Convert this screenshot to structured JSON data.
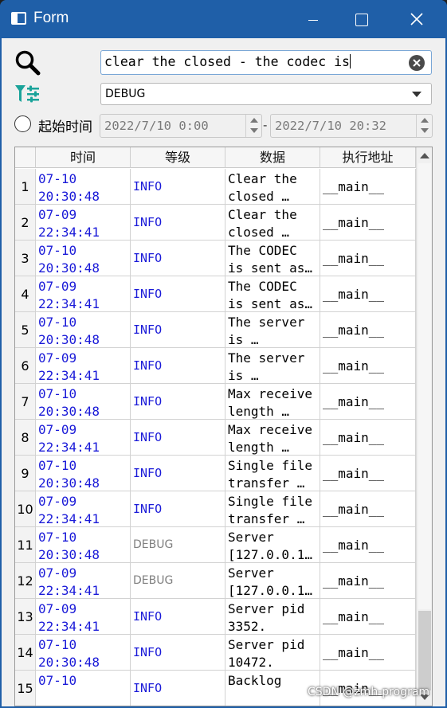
{
  "window": {
    "title": "Form"
  },
  "search": {
    "value": "clear the closed - the codec is"
  },
  "level": {
    "selected": "DEBUG"
  },
  "time_filter": {
    "label": "起始时间",
    "start": "2022/7/10 0:00",
    "separator": "-",
    "end": "2022/7/10 20:32"
  },
  "table": {
    "headers": [
      "时间",
      "等级",
      "数据",
      "执行地址"
    ],
    "rows": [
      {
        "num": "1",
        "date": "07-10",
        "time": "20:30:48",
        "level": "INFO",
        "data1": "Clear the",
        "data2": "closed …",
        "addr": "__main__"
      },
      {
        "num": "2",
        "date": "07-09",
        "time": "22:34:41",
        "level": "INFO",
        "data1": "Clear the",
        "data2": "closed …",
        "addr": "__main__"
      },
      {
        "num": "3",
        "date": "07-10",
        "time": "20:30:48",
        "level": "INFO",
        "data1": "The CODEC",
        "data2": "is sent as…",
        "addr": "__main__"
      },
      {
        "num": "4",
        "date": "07-09",
        "time": "22:34:41",
        "level": "INFO",
        "data1": "The CODEC",
        "data2": "is sent as…",
        "addr": "__main__"
      },
      {
        "num": "5",
        "date": "07-10",
        "time": "20:30:48",
        "level": "INFO",
        "data1": "The server",
        "data2": "is …",
        "addr": "__main__"
      },
      {
        "num": "6",
        "date": "07-09",
        "time": "22:34:41",
        "level": "INFO",
        "data1": "The server",
        "data2": "is …",
        "addr": "__main__"
      },
      {
        "num": "7",
        "date": "07-10",
        "time": "20:30:48",
        "level": "INFO",
        "data1": "Max receive",
        "data2": "length …",
        "addr": "__main__"
      },
      {
        "num": "8",
        "date": "07-09",
        "time": "22:34:41",
        "level": "INFO",
        "data1": "Max receive",
        "data2": "length …",
        "addr": "__main__"
      },
      {
        "num": "9",
        "date": "07-10",
        "time": "20:30:48",
        "level": "INFO",
        "data1": "Single file",
        "data2": "transfer …",
        "addr": "__main__"
      },
      {
        "num": "10",
        "date": "07-09",
        "time": "22:34:41",
        "level": "INFO",
        "data1": "Single file",
        "data2": "transfer …",
        "addr": "__main__"
      },
      {
        "num": "11",
        "date": "07-10",
        "time": "20:30:48",
        "level": "DEBUG",
        "data1": "Server",
        "data2": "[127.0.0.1…",
        "addr": "__main__"
      },
      {
        "num": "12",
        "date": "07-09",
        "time": "22:34:41",
        "level": "DEBUG",
        "data1": "Server",
        "data2": "[127.0.0.1…",
        "addr": "__main__"
      },
      {
        "num": "13",
        "date": "07-09",
        "time": "22:34:41",
        "level": "INFO",
        "data1": "Server pid",
        "data2": "3352.",
        "addr": "__main__"
      },
      {
        "num": "14",
        "date": "07-10",
        "time": "20:30:48",
        "level": "INFO",
        "data1": "Server pid",
        "data2": "10472.",
        "addr": "__main__"
      },
      {
        "num": "15",
        "date": "07-10",
        "time": "",
        "level": "INFO",
        "data1": "Backlog",
        "data2": "",
        "addr": "__main__"
      }
    ]
  },
  "watermark": "CSDN @zmh-program",
  "colors": {
    "titlebar": "#1f5fa8",
    "info_text": "#1a1ad8",
    "debug_text": "#808080",
    "filter_icon": "#1aa39a"
  }
}
